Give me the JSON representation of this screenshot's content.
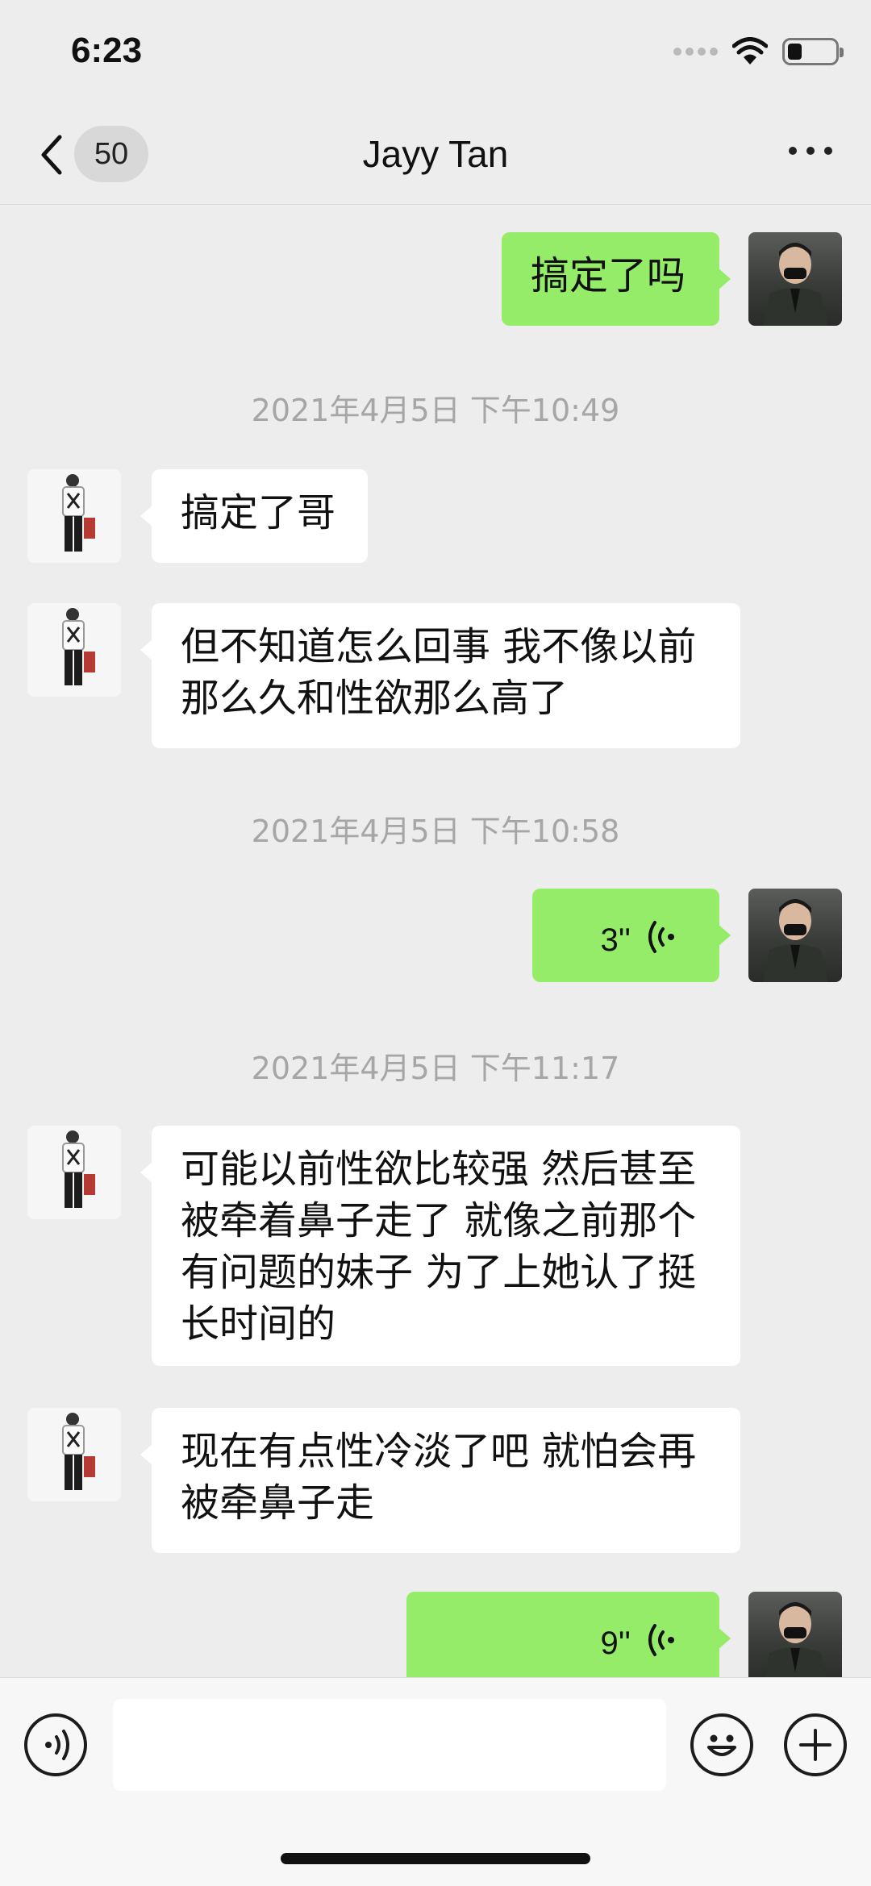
{
  "status_bar": {
    "time": "6:23"
  },
  "header": {
    "unread_count": "50",
    "title": "Jayy Tan"
  },
  "messages": [
    {
      "type": "text",
      "direction": "out",
      "text": "搞定了吗"
    },
    {
      "type": "timestamp",
      "text": "2021年4月5日 下午10:49"
    },
    {
      "type": "text",
      "direction": "in",
      "text": "搞定了哥"
    },
    {
      "type": "text",
      "direction": "in",
      "lines": [
        "但不知道怎么回事 我不像以前",
        "那么久和性欲那么高了"
      ]
    },
    {
      "type": "timestamp",
      "text": "2021年4月5日 下午10:58"
    },
    {
      "type": "voice",
      "direction": "out",
      "duration": "3''"
    },
    {
      "type": "timestamp",
      "text": "2021年4月5日 下午11:17"
    },
    {
      "type": "text",
      "direction": "in",
      "lines": [
        "可能以前性欲比较强 然后甚至",
        "被牵着鼻子走了 就像之前那个",
        "有问题的妹子 为了上她认了挺",
        "长时间的"
      ]
    },
    {
      "type": "text",
      "direction": "in",
      "lines": [
        "现在有点性冷淡了吧 就怕会再",
        "被牵鼻子走"
      ]
    },
    {
      "type": "voice",
      "direction": "out",
      "duration": "9''"
    }
  ],
  "input_bar": {
    "value": "",
    "left_icon": "voice-mode-icon",
    "right_icons": [
      "emoji-icon",
      "plus-icon"
    ]
  },
  "colors": {
    "background": "#ededed",
    "bubble_out": "#95ec69",
    "bubble_in": "#ffffff",
    "timestamp_text": "#a6a6a6"
  }
}
